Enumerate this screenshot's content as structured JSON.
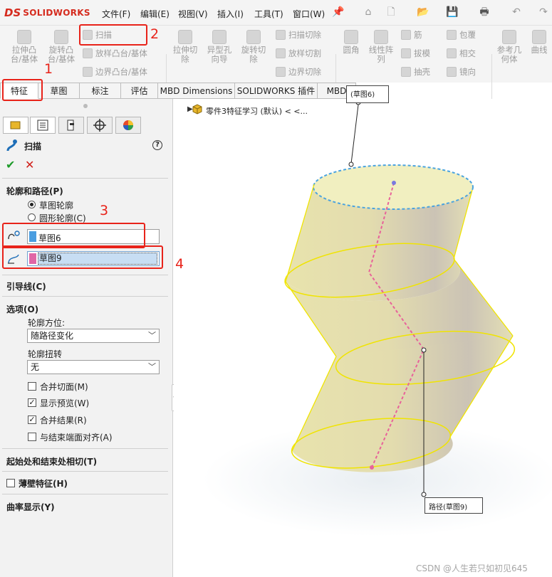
{
  "app": {
    "logo_mark": "DS",
    "logo_text": "SOLIDWORKS"
  },
  "menu": [
    "文件(F)",
    "编辑(E)",
    "视图(V)",
    "插入(I)",
    "工具(T)",
    "窗口(W)"
  ],
  "ribbon": {
    "extrude_boss": [
      "拉伸凸",
      "台/基体"
    ],
    "revolve_boss": [
      "旋转凸",
      "台/基体"
    ],
    "sweep": "扫描",
    "loft_boss": "放样凸台/基体",
    "boundary_boss": "边界凸台/基体",
    "extrude_cut": [
      "拉伸切",
      "除"
    ],
    "hole_wizard": [
      "异型孔",
      "向导"
    ],
    "revolve_cut": [
      "旋转切",
      "除"
    ],
    "swept_cut": "扫描切除",
    "lofted_cut": "放样切割",
    "boundary_cut": "边界切除",
    "fillet": "圆角",
    "linear_pattern": [
      "线性阵",
      "列"
    ],
    "rib": "筋",
    "draft": "拔模",
    "shell": "抽壳",
    "wrap": "包覆",
    "intersect": "相交",
    "mirror": "镜向",
    "ref_geometry": [
      "参考几",
      "何体"
    ],
    "curves": "曲线"
  },
  "tabs": [
    "特征",
    "草图",
    "标注",
    "评估",
    "MBD Dimensions",
    "SOLIDWORKS 插件",
    "MBD"
  ],
  "annotations": [
    "1",
    "2",
    "3",
    "4"
  ],
  "pm": {
    "title": "扫描",
    "ok": "✔",
    "cancel": "✕",
    "help": "?",
    "section_profile": "轮廓和路径(P)",
    "radio_sketch": "草图轮廓",
    "radio_circle": "圆形轮廓(C)",
    "profile_value": "草图6",
    "path_value": "草图9",
    "section_guide": "引导线(C)",
    "section_options": "选项(O)",
    "orientation_label": "轮廓方位:",
    "orientation_value": "随路径变化",
    "twist_label": "轮廓扭转",
    "twist_value": "无",
    "cb_merge_tangent": "合并切面(M)",
    "cb_preview": "显示预览(W)",
    "cb_merge_result": "合并结果(R)",
    "cb_align_end": "与结束端面对齐(A)",
    "section_tangency": "起始处和结束处相切(T)",
    "section_thin": "薄壁特征(H)",
    "section_curvature": "曲率显示(Y)"
  },
  "tree": {
    "part": "零件3特征学习 (默认) < <..."
  },
  "callouts": {
    "profile": "(草图6)",
    "path": "路径(草图9)"
  },
  "watermark": "CSDN @人生若只如初见645",
  "colors": {
    "accent_red": "#e8231a",
    "body": "#e9e4b0",
    "path": "#e8629a",
    "profile_edge": "#4aa3df",
    "brand": "#d52b1e"
  }
}
